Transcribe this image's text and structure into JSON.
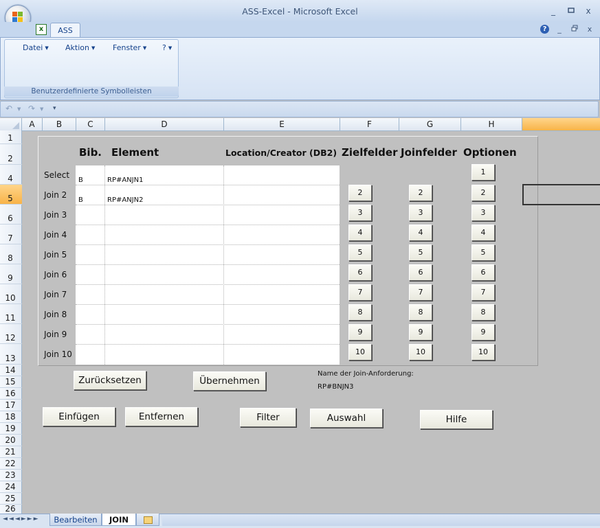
{
  "window": {
    "title": "ASS-Excel - Microsoft Excel",
    "minimize": "_",
    "restore": "▫",
    "close": "x"
  },
  "ribbon": {
    "tab_label": "ASS",
    "help": "?",
    "menus": [
      {
        "label": "Datei"
      },
      {
        "label": "Aktion"
      },
      {
        "label": "Fenster"
      },
      {
        "label": "?"
      }
    ],
    "group_label": "Benutzerdefinierte Symbolleisten"
  },
  "columns": [
    "A",
    "B",
    "C",
    "D",
    "E",
    "F",
    "G",
    "H"
  ],
  "rows": [
    "1",
    "2",
    "4",
    "5",
    "6",
    "7",
    "8",
    "9",
    "10",
    "11",
    "12",
    "13",
    "14",
    "15",
    "16",
    "17",
    "18",
    "19",
    "20",
    "21",
    "22",
    "23",
    "24",
    "25",
    "26"
  ],
  "form": {
    "headers": {
      "bib": "Bib.",
      "element": "Element",
      "location": "Location/Creator (DB2)",
      "zielfelder": "Zielfelder",
      "joinfelder": "Joinfelder",
      "optionen": "Optionen"
    },
    "row_labels": [
      "Select",
      "Join 2",
      "Join 3",
      "Join 4",
      "Join 5",
      "Join 6",
      "Join 7",
      "Join 8",
      "Join 9",
      "Join 10"
    ],
    "entries": [
      {
        "bib": "B",
        "element": "RP#ANJN1",
        "location": ""
      },
      {
        "bib": "B",
        "element": "RP#ANJN2",
        "location": ""
      },
      {
        "bib": "",
        "element": "",
        "location": ""
      },
      {
        "bib": "",
        "element": "",
        "location": ""
      },
      {
        "bib": "",
        "element": "",
        "location": ""
      },
      {
        "bib": "",
        "element": "",
        "location": ""
      },
      {
        "bib": "",
        "element": "",
        "location": ""
      },
      {
        "bib": "",
        "element": "",
        "location": ""
      },
      {
        "bib": "",
        "element": "",
        "location": ""
      },
      {
        "bib": "",
        "element": "",
        "location": ""
      }
    ],
    "zielfelder_buttons": [
      "2",
      "3",
      "4",
      "5",
      "6",
      "7",
      "8",
      "9",
      "10"
    ],
    "joinfelder_buttons": [
      "2",
      "3",
      "4",
      "5",
      "6",
      "7",
      "8",
      "9",
      "10"
    ],
    "optionen_buttons": [
      "1",
      "2",
      "3",
      "4",
      "5",
      "6",
      "7",
      "8",
      "9",
      "10"
    ],
    "actions": {
      "reset": "Zurücksetzen",
      "apply": "Übernehmen",
      "insert": "Einfügen",
      "remove": "Entfernen",
      "filter": "Filter",
      "selection": "Auswahl",
      "help": "Hilfe"
    },
    "join_request_label": "Name der Join-Anforderung:",
    "join_request_value": "RP#BNJN3"
  },
  "sheets": [
    {
      "label": "Bearbeiten",
      "active": false
    },
    {
      "label": "JOIN",
      "active": true
    }
  ],
  "nav_arrows": "◄◄◄►►►",
  "colors": {
    "accent": "#f8b348",
    "ribbon_text": "#15428b",
    "sheet_bg": "#c0c0c0"
  }
}
